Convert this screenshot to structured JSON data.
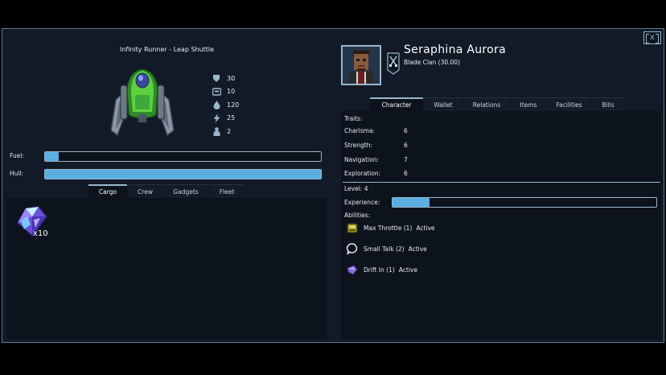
{
  "window": {
    "close_label": "x"
  },
  "ship": {
    "title": "Infinity Runner - Leap Shuttle",
    "stats": [
      {
        "icon": "shield-icon",
        "value": "30"
      },
      {
        "icon": "cargo-crate-icon",
        "value": "10"
      },
      {
        "icon": "fuel-drop-icon",
        "value": "120"
      },
      {
        "icon": "lightning-icon",
        "value": "25"
      },
      {
        "icon": "crew-person-icon",
        "value": "2"
      }
    ],
    "fuel_label": "Fuel:",
    "fuel_level": 0.05,
    "hull_label": "Hull:",
    "hull_level": 1.0,
    "tabs": [
      "Cargo",
      "Crew",
      "Gadgets",
      "Fleet"
    ],
    "cargo": [
      {
        "icon": "crystal-icon",
        "count": "x10"
      }
    ]
  },
  "character": {
    "name": "Seraphina Aurora",
    "clan": "Blade Clan  (30.00)",
    "tabs": [
      "Character",
      "Wallet",
      "Relations",
      "Items",
      "Facilities",
      "Bills"
    ],
    "traits_label": "Traits:",
    "traits": [
      {
        "name": "Charisma:",
        "value": "6"
      },
      {
        "name": "Strength:",
        "value": "6"
      },
      {
        "name": "Navigation:",
        "value": "7"
      },
      {
        "name": "Exploration:",
        "value": "6"
      }
    ],
    "level_label": "Level: 4",
    "experience_label": "Experience:",
    "experience_level": 0.14,
    "abilities_label": "Abilities:",
    "abilities": [
      {
        "icon": "throttle-icon",
        "name": "Max Throttle (1)",
        "status": "Active"
      },
      {
        "icon": "speech-icon",
        "name": "Small Talk (2)",
        "status": "Active"
      },
      {
        "icon": "drift-icon",
        "name": "Drift In (1)",
        "status": "Active"
      }
    ]
  }
}
